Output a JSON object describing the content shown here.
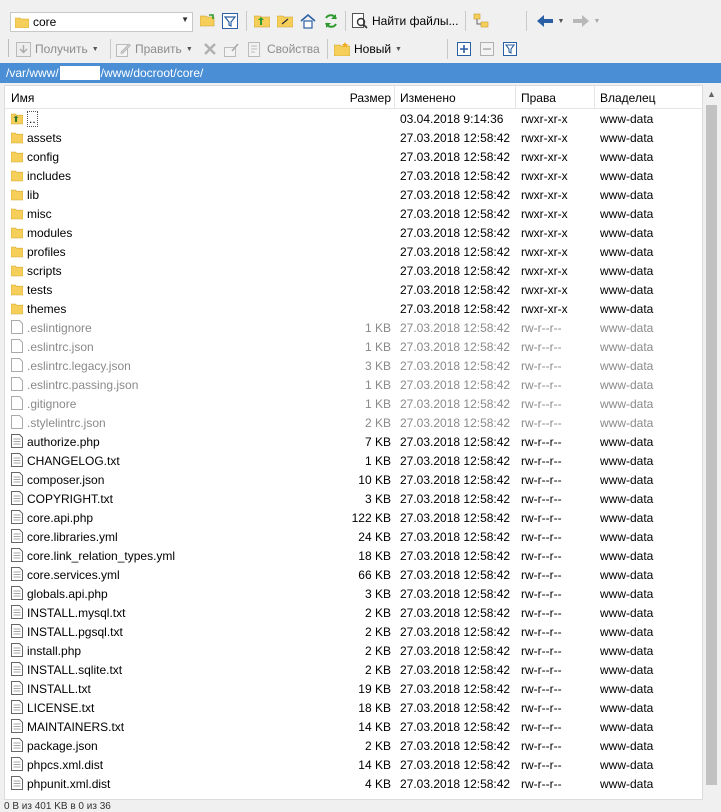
{
  "toolbar": {
    "folder_combo_value": "core",
    "find_files_label": "Найти файлы..."
  },
  "toolbar2": {
    "get_label": "Получить",
    "edit_label": "Править",
    "properties_label": "Свойства",
    "new_label": "Новый"
  },
  "path": {
    "prefix": "/var/www/",
    "suffix": "/www/docroot/core/"
  },
  "columns": {
    "name": "Имя",
    "size": "Размер",
    "modified": "Изменено",
    "rights": "Права",
    "owner": "Владелец"
  },
  "files": [
    {
      "name": "..",
      "size": "",
      "modified": "03.04.2018 9:14:36",
      "rights": "rwxr-xr-x",
      "owner": "www-data",
      "type": "up"
    },
    {
      "name": "assets",
      "size": "",
      "modified": "27.03.2018 12:58:42",
      "rights": "rwxr-xr-x",
      "owner": "www-data",
      "type": "folder"
    },
    {
      "name": "config",
      "size": "",
      "modified": "27.03.2018 12:58:42",
      "rights": "rwxr-xr-x",
      "owner": "www-data",
      "type": "folder"
    },
    {
      "name": "includes",
      "size": "",
      "modified": "27.03.2018 12:58:42",
      "rights": "rwxr-xr-x",
      "owner": "www-data",
      "type": "folder"
    },
    {
      "name": "lib",
      "size": "",
      "modified": "27.03.2018 12:58:42",
      "rights": "rwxr-xr-x",
      "owner": "www-data",
      "type": "folder"
    },
    {
      "name": "misc",
      "size": "",
      "modified": "27.03.2018 12:58:42",
      "rights": "rwxr-xr-x",
      "owner": "www-data",
      "type": "folder"
    },
    {
      "name": "modules",
      "size": "",
      "modified": "27.03.2018 12:58:42",
      "rights": "rwxr-xr-x",
      "owner": "www-data",
      "type": "folder"
    },
    {
      "name": "profiles",
      "size": "",
      "modified": "27.03.2018 12:58:42",
      "rights": "rwxr-xr-x",
      "owner": "www-data",
      "type": "folder"
    },
    {
      "name": "scripts",
      "size": "",
      "modified": "27.03.2018 12:58:42",
      "rights": "rwxr-xr-x",
      "owner": "www-data",
      "type": "folder"
    },
    {
      "name": "tests",
      "size": "",
      "modified": "27.03.2018 12:58:42",
      "rights": "rwxr-xr-x",
      "owner": "www-data",
      "type": "folder"
    },
    {
      "name": "themes",
      "size": "",
      "modified": "27.03.2018 12:58:42",
      "rights": "rwxr-xr-x",
      "owner": "www-data",
      "type": "folder"
    },
    {
      "name": ".eslintignore",
      "size": "1 KB",
      "modified": "27.03.2018 12:58:42",
      "rights": "rw-r--r--",
      "owner": "www-data",
      "type": "hidden"
    },
    {
      "name": ".eslintrc.json",
      "size": "1 KB",
      "modified": "27.03.2018 12:58:42",
      "rights": "rw-r--r--",
      "owner": "www-data",
      "type": "hidden"
    },
    {
      "name": ".eslintrc.legacy.json",
      "size": "3 KB",
      "modified": "27.03.2018 12:58:42",
      "rights": "rw-r--r--",
      "owner": "www-data",
      "type": "hidden"
    },
    {
      "name": ".eslintrc.passing.json",
      "size": "1 KB",
      "modified": "27.03.2018 12:58:42",
      "rights": "rw-r--r--",
      "owner": "www-data",
      "type": "hidden"
    },
    {
      "name": ".gitignore",
      "size": "1 KB",
      "modified": "27.03.2018 12:58:42",
      "rights": "rw-r--r--",
      "owner": "www-data",
      "type": "hidden"
    },
    {
      "name": ".stylelintrc.json",
      "size": "2 KB",
      "modified": "27.03.2018 12:58:42",
      "rights": "rw-r--r--",
      "owner": "www-data",
      "type": "hidden"
    },
    {
      "name": "authorize.php",
      "size": "7 KB",
      "modified": "27.03.2018 12:58:42",
      "rights": "rw-r--r--",
      "owner": "www-data",
      "type": "file"
    },
    {
      "name": "CHANGELOG.txt",
      "size": "1 KB",
      "modified": "27.03.2018 12:58:42",
      "rights": "rw-r--r--",
      "owner": "www-data",
      "type": "file"
    },
    {
      "name": "composer.json",
      "size": "10 KB",
      "modified": "27.03.2018 12:58:42",
      "rights": "rw-r--r--",
      "owner": "www-data",
      "type": "file"
    },
    {
      "name": "COPYRIGHT.txt",
      "size": "3 KB",
      "modified": "27.03.2018 12:58:42",
      "rights": "rw-r--r--",
      "owner": "www-data",
      "type": "file"
    },
    {
      "name": "core.api.php",
      "size": "122 KB",
      "modified": "27.03.2018 12:58:42",
      "rights": "rw-r--r--",
      "owner": "www-data",
      "type": "file"
    },
    {
      "name": "core.libraries.yml",
      "size": "24 KB",
      "modified": "27.03.2018 12:58:42",
      "rights": "rw-r--r--",
      "owner": "www-data",
      "type": "file"
    },
    {
      "name": "core.link_relation_types.yml",
      "size": "18 KB",
      "modified": "27.03.2018 12:58:42",
      "rights": "rw-r--r--",
      "owner": "www-data",
      "type": "file"
    },
    {
      "name": "core.services.yml",
      "size": "66 KB",
      "modified": "27.03.2018 12:58:42",
      "rights": "rw-r--r--",
      "owner": "www-data",
      "type": "file"
    },
    {
      "name": "globals.api.php",
      "size": "3 KB",
      "modified": "27.03.2018 12:58:42",
      "rights": "rw-r--r--",
      "owner": "www-data",
      "type": "file"
    },
    {
      "name": "INSTALL.mysql.txt",
      "size": "2 KB",
      "modified": "27.03.2018 12:58:42",
      "rights": "rw-r--r--",
      "owner": "www-data",
      "type": "file"
    },
    {
      "name": "INSTALL.pgsql.txt",
      "size": "2 KB",
      "modified": "27.03.2018 12:58:42",
      "rights": "rw-r--r--",
      "owner": "www-data",
      "type": "file"
    },
    {
      "name": "install.php",
      "size": "2 KB",
      "modified": "27.03.2018 12:58:42",
      "rights": "rw-r--r--",
      "owner": "www-data",
      "type": "file"
    },
    {
      "name": "INSTALL.sqlite.txt",
      "size": "2 KB",
      "modified": "27.03.2018 12:58:42",
      "rights": "rw-r--r--",
      "owner": "www-data",
      "type": "file"
    },
    {
      "name": "INSTALL.txt",
      "size": "19 KB",
      "modified": "27.03.2018 12:58:42",
      "rights": "rw-r--r--",
      "owner": "www-data",
      "type": "file"
    },
    {
      "name": "LICENSE.txt",
      "size": "18 KB",
      "modified": "27.03.2018 12:58:42",
      "rights": "rw-r--r--",
      "owner": "www-data",
      "type": "file"
    },
    {
      "name": "MAINTAINERS.txt",
      "size": "14 KB",
      "modified": "27.03.2018 12:58:42",
      "rights": "rw-r--r--",
      "owner": "www-data",
      "type": "file"
    },
    {
      "name": "package.json",
      "size": "2 KB",
      "modified": "27.03.2018 12:58:42",
      "rights": "rw-r--r--",
      "owner": "www-data",
      "type": "file"
    },
    {
      "name": "phpcs.xml.dist",
      "size": "14 KB",
      "modified": "27.03.2018 12:58:42",
      "rights": "rw-r--r--",
      "owner": "www-data",
      "type": "file"
    },
    {
      "name": "phpunit.xml.dist",
      "size": "4 KB",
      "modified": "27.03.2018 12:58:42",
      "rights": "rw-r--r--",
      "owner": "www-data",
      "type": "file"
    }
  ],
  "status_text": "0 B из 401 KB в 0 из 36",
  "colors": {
    "path_bar": "#4a8fd6",
    "folder": "#f5cf5a",
    "hidden_text": "#8a8a8a"
  }
}
